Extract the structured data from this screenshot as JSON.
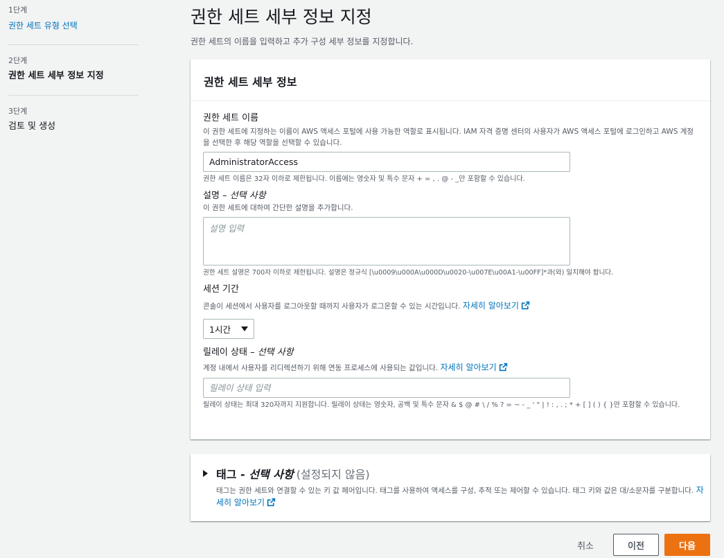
{
  "sidebar": {
    "steps": [
      {
        "num": "1단계",
        "title": "권한 세트 유형 선택"
      },
      {
        "num": "2단계",
        "title": "권한 세트 세부 정보 지정"
      },
      {
        "num": "3단계",
        "title": "검토 및 생성"
      }
    ]
  },
  "header": {
    "title": "권한 세트 세부 정보 지정",
    "description": "권한 세트의 이름을 입력하고 추가 구성 세부 정보를 지정합니다."
  },
  "details": {
    "title": "권한 세트 세부 정보",
    "name": {
      "label": "권한 세트 이름",
      "description": "이 권한 세트에 지정하는 이름이 AWS 액세스 포털에 사용 가능한 역할로 표시됩니다. IAM 자격 증명 센터의 사용자가 AWS 액세스 포털에 로그인하고 AWS 계정을 선택한 후 해당 역할을 선택할 수 있습니다.",
      "value": "AdministratorAccess",
      "constraint": "권한 세트 이름은 32자 이하로 제한됩니다. 이름에는 영숫자 및 특수 문자 + = , . @ - _만 포함할 수 있습니다."
    },
    "description_field": {
      "label": "설명 – ",
      "label_optional": "선택 사항",
      "description": "이 권한 세트에 대하여 간단한 설명을 추가합니다.",
      "placeholder": "설명 입력",
      "constraint": "권한 세트 설명은 700자 이하로 제한됩니다. 설명은 정규식 [\\u0009\\u000A\\u000D\\u0020-\\u007E\\u00A1-\\u00FF]*과(와) 일치해야 합니다."
    },
    "session": {
      "label": "세션 기간",
      "description": "콘솔이 세션에서 사용자를 로그아웃할 때까지 사용자가 로그온할 수 있는 시간입니다.",
      "learn_more": "자세히 알아보기",
      "selected": "1시간"
    },
    "relay": {
      "label": "릴레이 상태 – ",
      "label_optional": "선택 사항",
      "description": "계정 내에서 사용자를 리디렉션하기 위해 연동 프로세스에 사용되는 값입니다.",
      "learn_more": "자세히 알아보기",
      "placeholder": "릴레이 상태 입력",
      "constraint": "릴레이 상태는 최대 320자까지 지원합니다. 릴레이 상태는 영숫자, 공백 및 특수 문자 & $ @ # \\ / % ? = ~ - _ ' \" | ! : , . ; * + [ ] ( ) { }만 포함할 수 있습니다."
    }
  },
  "tags": {
    "title": "태그 - ",
    "title_optional": "선택 사항",
    "status": "(설정되지 않음)",
    "description": "태그는 권한 세트와 연결할 수 있는 키 값 페어입니다. 태그를 사용하여 액세스를 구성, 추적 또는 제어할 수 있습니다. 태그 키와 값은 대/소문자를 구분합니다.",
    "learn_more": "자세히 알아보기"
  },
  "footer": {
    "cancel": "취소",
    "previous": "이전",
    "next": "다음"
  },
  "colors": {
    "link": "#0073bb",
    "primary": "#ec7211"
  }
}
